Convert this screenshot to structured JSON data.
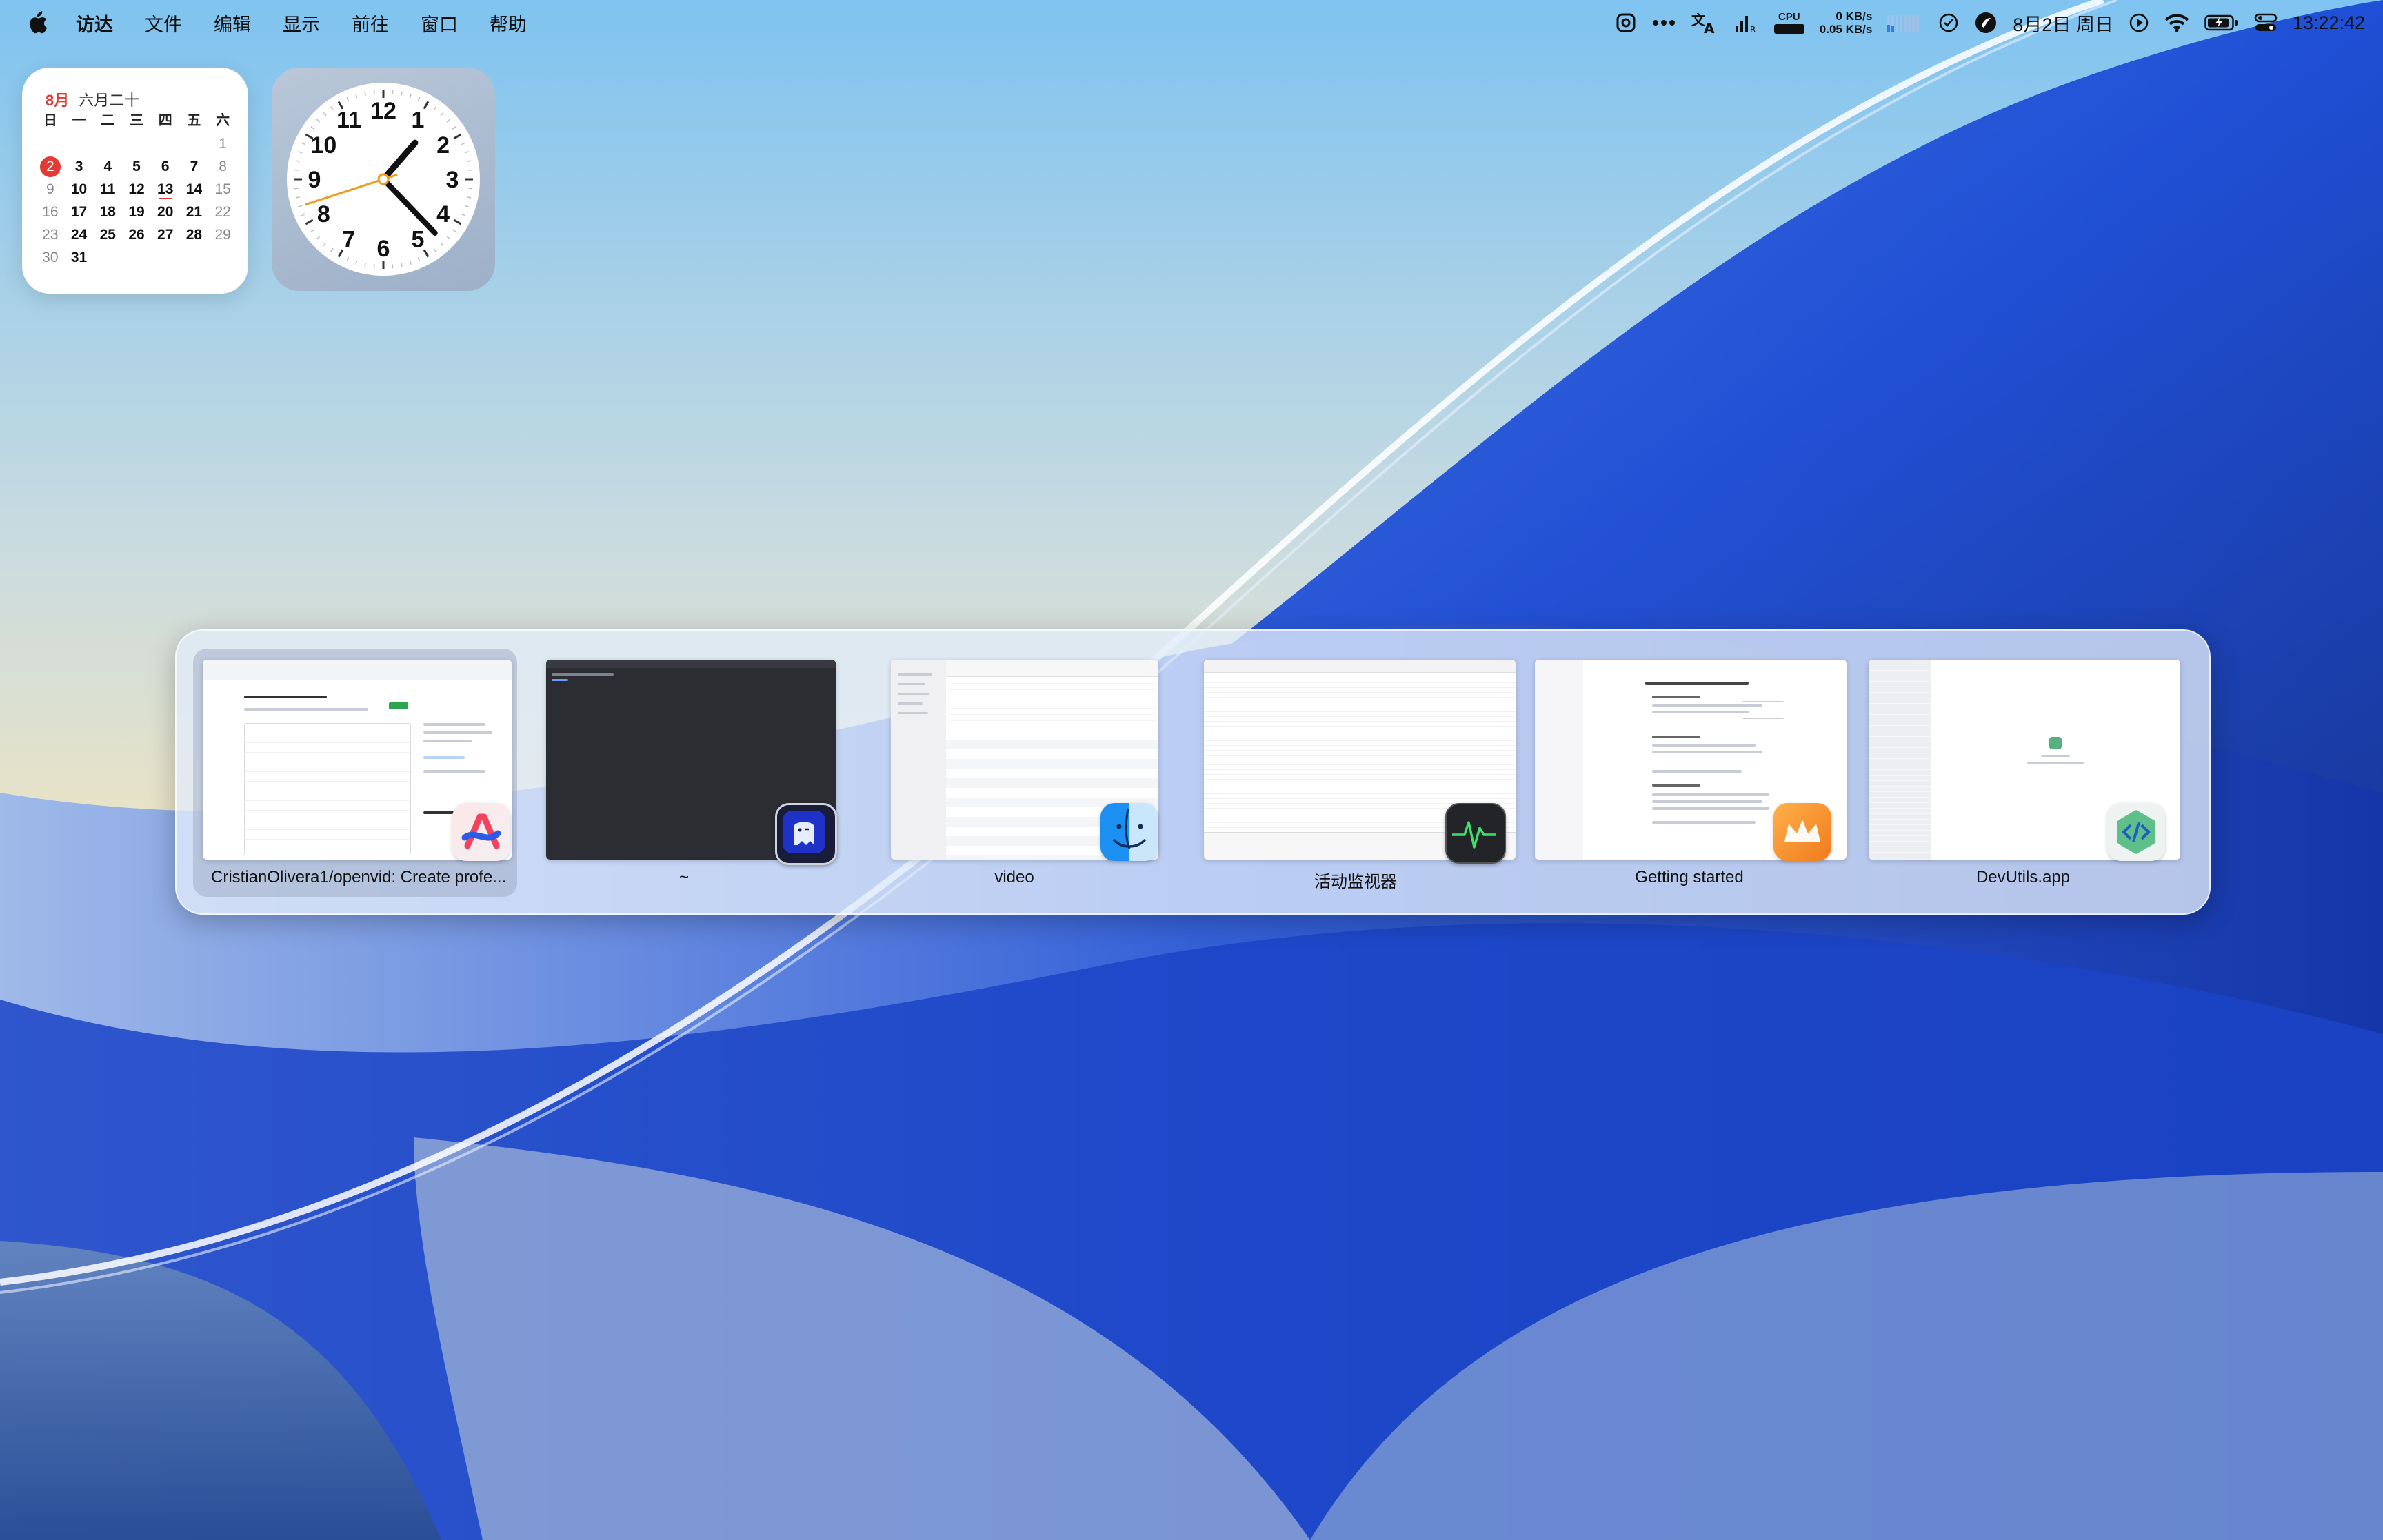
{
  "menubar": {
    "apple_icon": "apple-logo-icon",
    "app_name": "访达",
    "menus": [
      "文件",
      "编辑",
      "显示",
      "前往",
      "窗口",
      "帮助"
    ],
    "status": {
      "cpu_label": "CPU",
      "net_up": "0 KB/s",
      "net_down": "0.05 KB/s",
      "date": "8月2日 周日",
      "time": "13:22:42"
    }
  },
  "calendar_widget": {
    "month": "8月",
    "lunar": "六月二十",
    "weekdays": [
      "日",
      "一",
      "二",
      "三",
      "四",
      "五",
      "六"
    ],
    "today": "2",
    "days": [
      "",
      "",
      "",
      "",
      "",
      "",
      "1",
      "2",
      "3",
      "4",
      "5",
      "6",
      "7",
      "8",
      "9",
      "10",
      "11",
      "12",
      "13",
      "14",
      "15",
      "16",
      "17",
      "18",
      "19",
      "20",
      "21",
      "22",
      "23",
      "24",
      "25",
      "26",
      "27",
      "28",
      "29",
      "30",
      "31",
      "",
      "",
      "",
      "",
      ""
    ]
  },
  "clock_widget": {
    "numbers": [
      "12",
      "1",
      "2",
      "3",
      "4",
      "5",
      "6",
      "7",
      "8",
      "9",
      "10",
      "11"
    ],
    "hour": 13,
    "minute": 22,
    "second": 42
  },
  "app_switcher": {
    "items": [
      {
        "label": "CristianOlivera1/openvid: Create profe...",
        "icon": "arc-browser-icon",
        "selected": true
      },
      {
        "label": "~",
        "icon": "ghostty-terminal-icon",
        "selected": false
      },
      {
        "label": "video",
        "icon": "finder-icon",
        "selected": false
      },
      {
        "label": "活动监视器",
        "icon": "activity-monitor-icon",
        "selected": false
      },
      {
        "label": "Getting started",
        "icon": "craft-docs-icon",
        "selected": false
      },
      {
        "label": "DevUtils.app",
        "icon": "devutils-icon",
        "selected": false
      }
    ]
  },
  "colors": {
    "accent_red": "#e53935",
    "wallpaper_blue": "#1f4fd6",
    "wallpaper_cream": "#e8e2c2"
  }
}
